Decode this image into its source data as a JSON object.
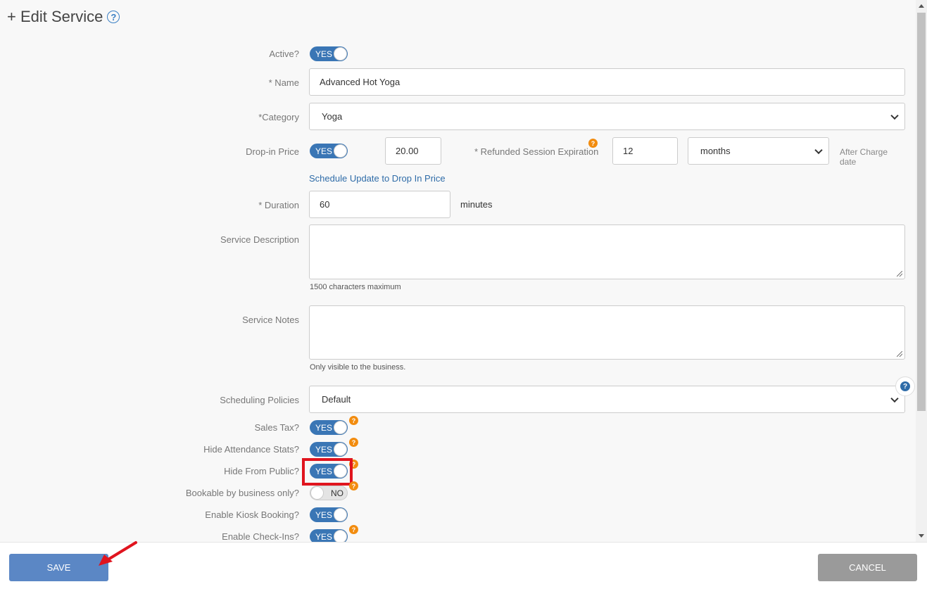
{
  "header": {
    "title": "+ Edit Service",
    "help_glyph": "?"
  },
  "fields": {
    "active": {
      "label": "Active?",
      "toggle": "YES"
    },
    "name": {
      "label": "* Name",
      "value": "Advanced Hot Yoga"
    },
    "category": {
      "label": "*Category",
      "value": "Yoga"
    },
    "dropin": {
      "label": "Drop-in Price",
      "toggle": "YES",
      "price": "20.00",
      "refund_label": "* Refunded Session Expiration",
      "refund_value": "12",
      "refund_unit": "months",
      "after_charge": "After Charge date",
      "schedule_link": "Schedule Update to Drop In Price"
    },
    "duration": {
      "label": "* Duration",
      "value": "60",
      "unit": "minutes"
    },
    "description": {
      "label": "Service Description",
      "hint": "1500 characters maximum"
    },
    "notes": {
      "label": "Service Notes",
      "hint": "Only visible to the business."
    },
    "policies": {
      "label": "Scheduling Policies",
      "value": "Default"
    },
    "toggles": [
      {
        "label": "Sales Tax?",
        "state": "YES"
      },
      {
        "label": "Hide Attendance Stats?",
        "state": "YES"
      },
      {
        "label": "Hide From Public?",
        "state": "YES"
      },
      {
        "label": "Bookable by business only?",
        "state": "NO"
      },
      {
        "label": "Enable Kiosk Booking?",
        "state": "YES"
      },
      {
        "label": "Enable Check-Ins?",
        "state": "YES"
      }
    ]
  },
  "footer": {
    "save_label": "SAVE",
    "cancel_label": "CANCEL"
  },
  "icons": {
    "help": "question-circle-icon",
    "info": "question-badge-icon",
    "dropdown": "chevron-down-icon"
  },
  "colors": {
    "toggle_on": "#3a76b5",
    "save_button": "#5b87c5",
    "cancel_button": "#9a9a9a",
    "highlight": "#e0141e",
    "info_badge": "#f28c0f"
  }
}
